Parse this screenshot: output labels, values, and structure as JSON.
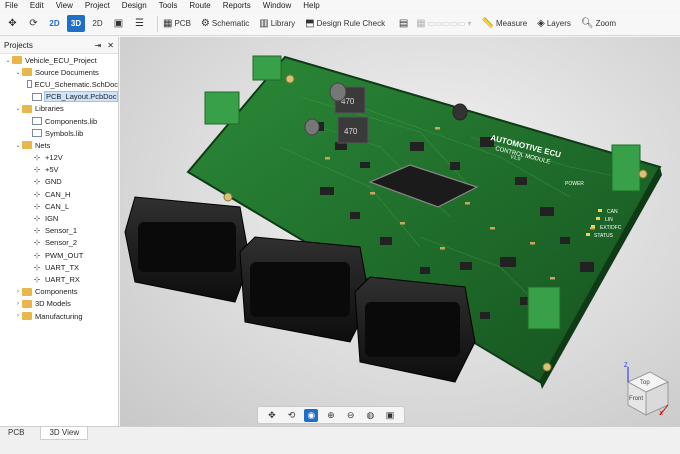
{
  "menu": [
    "File",
    "Edit",
    "View",
    "Project",
    "Design",
    "Tools",
    "Route",
    "Reports",
    "Window",
    "Help"
  ],
  "toolbar": {
    "btn_2d_a": "2D",
    "btn_3d": "3D",
    "btn_2d_b": "2D",
    "pcb": "PCB",
    "schematic": "Schematic",
    "library": "Library",
    "design_rule_check": "Design Rule Check",
    "measure": "Measure",
    "layers": "Layers",
    "zoom": "Zoom"
  },
  "panel": {
    "title": "Projects",
    "tree": [
      {
        "label": "Vehicle_ECU_Project",
        "level": 0,
        "twisty": "open",
        "icon": "project"
      },
      {
        "label": "Source Documents",
        "level": 1,
        "twisty": "open",
        "icon": "folder"
      },
      {
        "label": "ECU_Schematic.SchDoc",
        "level": 2,
        "icon": "doc"
      },
      {
        "label": "PCB_Layout.PcbDoc",
        "level": 2,
        "icon": "doc",
        "selected": true
      },
      {
        "label": "Libraries",
        "level": 1,
        "twisty": "open",
        "icon": "folder"
      },
      {
        "label": "Components.lib",
        "level": 2,
        "icon": "doc"
      },
      {
        "label": "Symbols.lib",
        "level": 2,
        "icon": "doc"
      },
      {
        "label": "Nets",
        "level": 1,
        "twisty": "open",
        "icon": "folder"
      },
      {
        "label": "+12V",
        "level": 2,
        "icon": "net"
      },
      {
        "label": "+5V",
        "level": 2,
        "icon": "net"
      },
      {
        "label": "GND",
        "level": 2,
        "icon": "net"
      },
      {
        "label": "CAN_H",
        "level": 2,
        "icon": "net"
      },
      {
        "label": "CAN_L",
        "level": 2,
        "icon": "net"
      },
      {
        "label": "IGN",
        "level": 2,
        "icon": "net"
      },
      {
        "label": "Sensor_1",
        "level": 2,
        "icon": "net"
      },
      {
        "label": "Sensor_2",
        "level": 2,
        "icon": "net"
      },
      {
        "label": "PWM_OUT",
        "level": 2,
        "icon": "net"
      },
      {
        "label": "UART_TX",
        "level": 2,
        "icon": "net"
      },
      {
        "label": "UART_RX",
        "level": 2,
        "icon": "net"
      },
      {
        "label": "Components",
        "level": 1,
        "twisty": "closed",
        "icon": "folder"
      },
      {
        "label": "3D Models",
        "level": 1,
        "twisty": "closed",
        "icon": "folder"
      },
      {
        "label": "Manufacturing",
        "level": 1,
        "twisty": "closed",
        "icon": "folder"
      }
    ]
  },
  "board": {
    "title": "AUTOMOTIVE ECU",
    "subtitle": "CONTROL MODULE",
    "version": "V1.0",
    "inductor_label_1": "470",
    "inductor_label_2": "470",
    "power_label": "POWER",
    "status_labels": [
      "CAN",
      "LIN",
      "EXT/DFC",
      "STATUS"
    ],
    "colors": {
      "board": "#1f6b2a",
      "connector": "#1c1c1c",
      "terminal": "#3aa04a"
    }
  },
  "viewcube": {
    "top": "Top",
    "front": "Front",
    "axis_x": "X",
    "axis_z": "Z"
  },
  "tabs": [
    "PCB",
    "3D View"
  ],
  "active_tab": "3D View",
  "accent": "#1f6fc5"
}
